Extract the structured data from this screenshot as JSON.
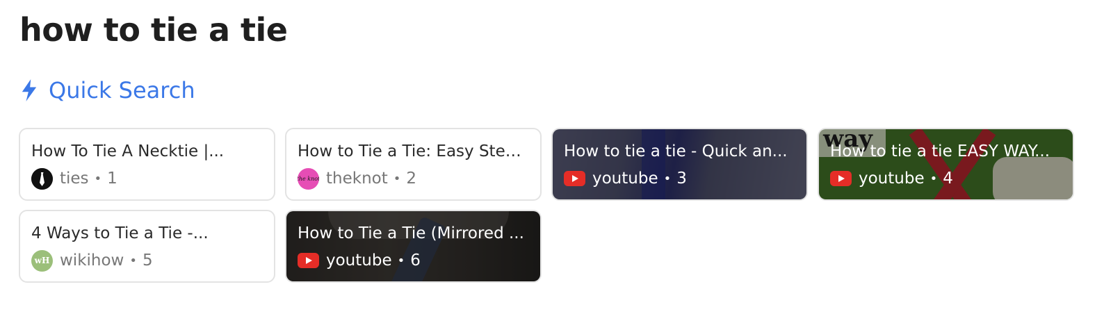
{
  "query": "how to tie a tie",
  "quick_search": {
    "icon": "lightning-icon",
    "label": "Quick Search",
    "color": "#3b78e7"
  },
  "results": [
    {
      "title": "How To Tie A Necktie |...",
      "source": "ties",
      "index": "1",
      "favicon": "ties-favicon",
      "background": "light"
    },
    {
      "title": "How to Tie a Tie: Easy Step...",
      "source": "theknot",
      "index": "2",
      "favicon": "theknot-favicon",
      "favicon_text": "the knot",
      "background": "light"
    },
    {
      "title": "How to tie a tie - Quick an...",
      "source": "youtube",
      "index": "3",
      "favicon": "youtube-icon",
      "background": "video-thumbnail"
    },
    {
      "title": "How to tie a tie EASY WAY...",
      "source": "youtube",
      "index": "4",
      "favicon": "youtube-icon",
      "background": "video-thumbnail",
      "thumbnail_text": "way"
    },
    {
      "title": "4 Ways to Tie a Tie -...",
      "source": "wikihow",
      "index": "5",
      "favicon": "wikihow-favicon",
      "favicon_text": "wH",
      "background": "light"
    },
    {
      "title": "How to Tie a Tie (Mirrored ...",
      "source": "youtube",
      "index": "6",
      "favicon": "youtube-icon",
      "background": "video-thumbnail"
    }
  ],
  "separator": "•"
}
